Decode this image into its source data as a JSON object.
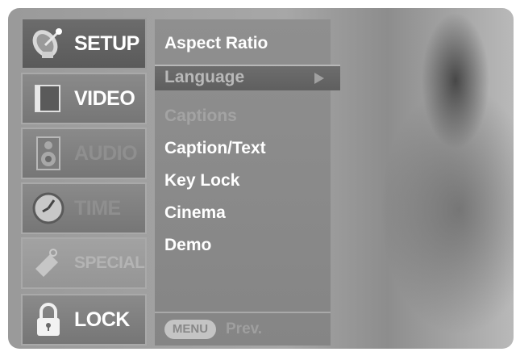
{
  "sidebar": {
    "items": [
      {
        "label": "SETUP",
        "icon": "satellite-dish-icon",
        "state": "active"
      },
      {
        "label": "VIDEO",
        "icon": "video-screen-icon",
        "state": "normal"
      },
      {
        "label": "AUDIO",
        "icon": "speaker-icon",
        "state": "dim"
      },
      {
        "label": "TIME",
        "icon": "clock-icon",
        "state": "dim"
      },
      {
        "label": "SPECIAL",
        "icon": "tag-icon",
        "state": "faint"
      },
      {
        "label": "LOCK",
        "icon": "padlock-icon",
        "state": "normal"
      }
    ]
  },
  "menu": {
    "items": [
      {
        "label": "Aspect Ratio",
        "state": "normal"
      },
      {
        "label": "Language",
        "state": "highlighted"
      },
      {
        "label": "Captions",
        "state": "disabled"
      },
      {
        "label": "Caption/Text",
        "state": "normal"
      },
      {
        "label": "Key Lock",
        "state": "normal"
      },
      {
        "label": "Cinema",
        "state": "normal"
      },
      {
        "label": "Demo",
        "state": "normal"
      }
    ],
    "submenu_arrow": "right-arrow-icon"
  },
  "footer": {
    "menu_button": "MENU",
    "hint": "Prev."
  }
}
